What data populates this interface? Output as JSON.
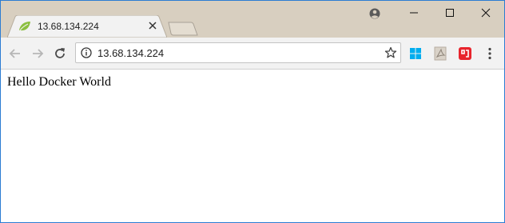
{
  "tab": {
    "title": "13.68.134.224"
  },
  "omnibox": {
    "url": "13.68.134.224"
  },
  "page": {
    "body_text": "Hello Docker World"
  },
  "icons": {
    "favicon": "spring-leaf-icon",
    "tab_close": "close-icon",
    "profile": "profile-icon",
    "back": "back-arrow-icon",
    "forward": "forward-arrow-icon",
    "reload": "reload-icon",
    "site_info": "info-icon",
    "bookmark": "star-icon",
    "extensions": [
      "windows-icon",
      "pdf-icon",
      "red-extension-icon"
    ],
    "menu": "more-vert-icon"
  },
  "colors": {
    "titlebar": "#d8cfc0",
    "active_tab": "#f2f2f2",
    "window_border": "#2b7cd3",
    "favicon_green": "#8bbf3f",
    "windows_blue": "#00adef",
    "extension_red": "#e8242c"
  }
}
